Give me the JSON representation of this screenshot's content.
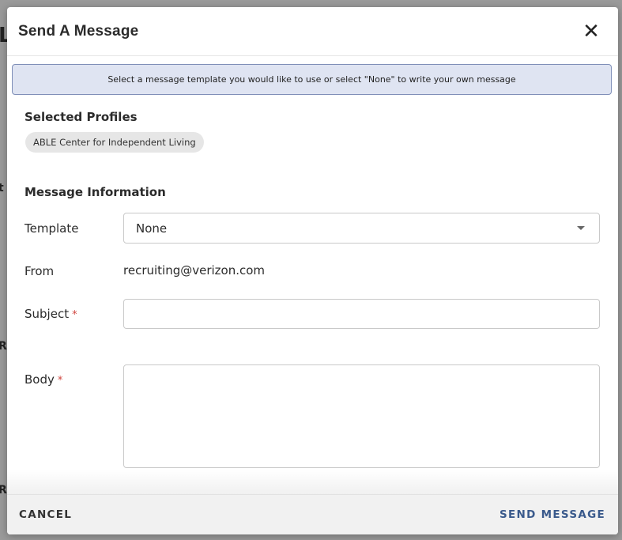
{
  "modal": {
    "title": "Send A Message",
    "close_icon": "close-icon",
    "banner_text": "Select a message template you would like to use or select \"None\" to write your own message"
  },
  "selected_profiles": {
    "heading": "Selected Profiles",
    "chips": [
      "ABLE Center for Independent Living"
    ]
  },
  "message_info": {
    "heading": "Message Information",
    "template_label": "Template",
    "template_value": "None",
    "from_label": "From",
    "from_value": "recruiting@verizon.com",
    "subject_label": "Subject",
    "subject_value": "",
    "body_label": "Body",
    "body_value": "",
    "required_mark": "*"
  },
  "footer": {
    "cancel_label": "CANCEL",
    "send_label": "SEND MESSAGE"
  },
  "colors": {
    "banner_bg": "#dfe4f2",
    "banner_border": "#7f8fb8",
    "send_accent": "#3a5a8c",
    "required": "#d0443e"
  }
}
